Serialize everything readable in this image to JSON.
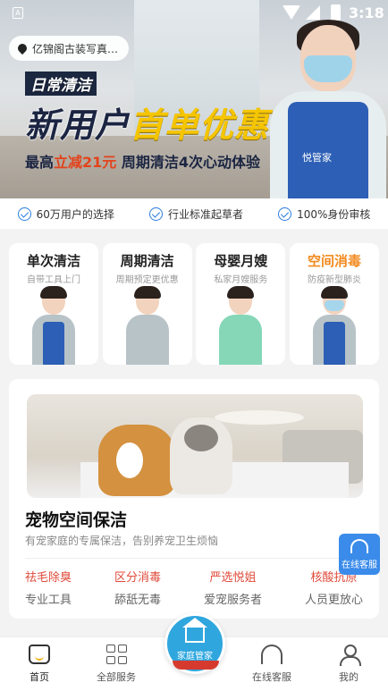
{
  "status_bar": {
    "time": "3:18",
    "sim_label": "A"
  },
  "banner": {
    "location": "亿锦阁古装写真…",
    "tag": "日常清洁",
    "headline_white": "新用户",
    "headline_yellow": "首单优惠",
    "sub_prefix": "最高",
    "sub_highlight": "立减21元",
    "sub_suffix": " 周期清洁4次心动体验",
    "apron_logo": "悦管家"
  },
  "trust": [
    {
      "label": "60万用户的选择",
      "icon": "check-circle-icon"
    },
    {
      "label": "行业标准起草者",
      "icon": "check-circle-icon"
    },
    {
      "label": "100%身份审核",
      "icon": "check-circle-icon"
    }
  ],
  "services": [
    {
      "title": "单次清洁",
      "desc": "自带工具上门",
      "highlight": false
    },
    {
      "title": "周期清洁",
      "desc": "周期预定更优惠",
      "highlight": false
    },
    {
      "title": "母婴月嫂",
      "desc": "私家月嫂服务",
      "highlight": false
    },
    {
      "title": "空间消毒",
      "desc": "防疫新型肺炎",
      "highlight": true
    }
  ],
  "pet_card": {
    "title": "宠物空间保洁",
    "tagline": "有宠家庭的专属保洁，告别养宠卫生烦恼",
    "features": [
      {
        "red": "祛毛除臭",
        "gray": "专业工具"
      },
      {
        "red": "区分消毒",
        "gray": "舔舐无毒"
      },
      {
        "red": "严选悦姐",
        "gray": "爱宠服务者"
      },
      {
        "red": "核酸抗原",
        "gray": "人员更放心"
      }
    ]
  },
  "floating_cs": {
    "label": "在线客服"
  },
  "nav": {
    "home": "首页",
    "all_services": "全部服务",
    "center": "家庭管家",
    "online_cs": "在线客服",
    "mine": "我的"
  },
  "colors": {
    "accent_blue": "#2fa6de",
    "promo_yellow": "#f5c500",
    "feature_red": "#e04a3a",
    "highlight_orange": "#f28a1e"
  }
}
